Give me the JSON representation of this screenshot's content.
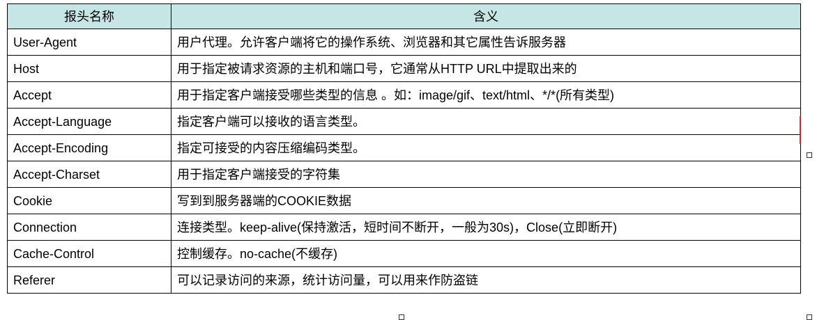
{
  "table": {
    "headers": [
      "报头名称",
      "含义"
    ],
    "rows": [
      [
        "User-Agent",
        "用户代理。允许客户端将它的操作系统、浏览器和其它属性告诉服务器"
      ],
      [
        "Host",
        "用于指定被请求资源的主机和端口号，它通常从HTTP URL中提取出来的"
      ],
      [
        "Accept",
        "用于指定客户端接受哪些类型的信息 。如：image/gif、text/html、*/*(所有类型)"
      ],
      [
        "Accept-Language",
        "指定客户端可以接收的语言类型。"
      ],
      [
        "Accept-Encoding",
        "指定可接受的内容压缩编码类型。"
      ],
      [
        "Accept-Charset",
        "用于指定客户端接受的字符集"
      ],
      [
        "Cookie",
        "写到到服务器端的COOKIE数据"
      ],
      [
        "Connection",
        "连接类型。keep-alive(保持激活，短时间不断开，一般为30s)，Close(立即断开)"
      ],
      [
        "Cache-Control",
        "控制缓存。no-cache(不缓存)"
      ],
      [
        "Referer",
        "可以记录访问的来源，统计访问量，可以用来作防盗链"
      ]
    ]
  },
  "colors": {
    "header_bg": "#c6e6e6",
    "border": "#000000",
    "selection_mark": "#e02020"
  }
}
